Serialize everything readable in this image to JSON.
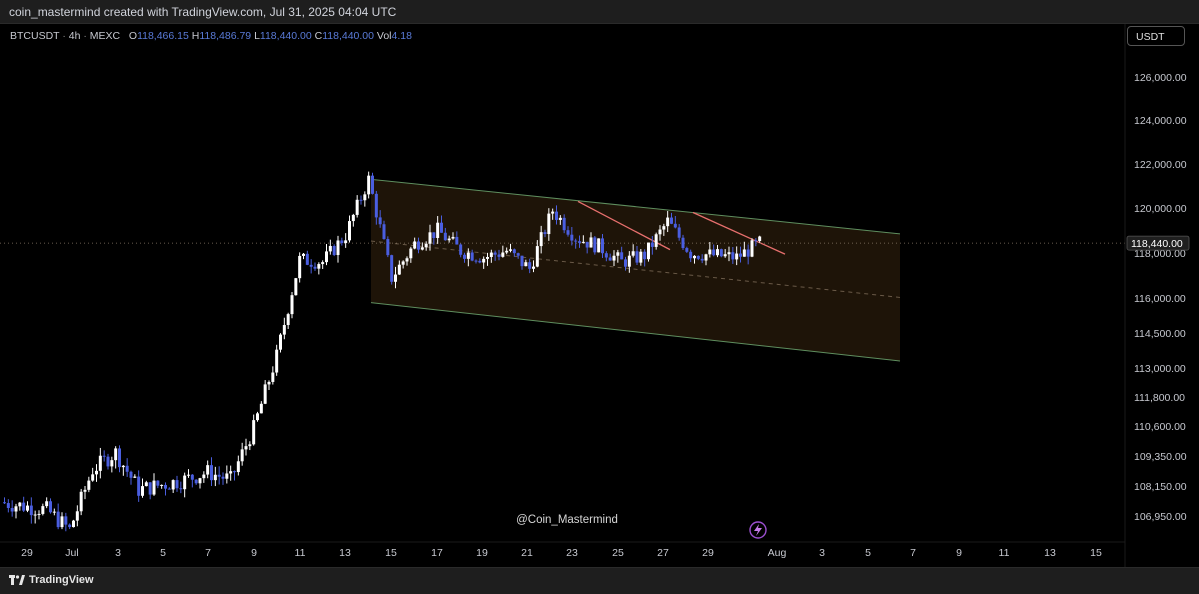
{
  "header": {
    "attribution": "coin_mastermind created with TradingView.com, Jul 31, 2025 04:04 UTC"
  },
  "legend": {
    "symbol": "BTCUSDT",
    "interval": "4h",
    "exchange": "MEXC",
    "o_label": "O",
    "o_value": "118,466.15",
    "h_label": "H",
    "h_value": "118,486.79",
    "l_label": "L",
    "l_value": "118,440.00",
    "c_label": "C",
    "c_value": "118,440.00",
    "vol_label": "Vol",
    "vol_value": "4.18"
  },
  "currency_button": "USDT",
  "watermark": "@Coin_Mastermind",
  "footer": {
    "brand": "TradingView"
  },
  "colors": {
    "up": "#ffffff",
    "down": "#4a5ee0",
    "channel_fill": "#1e1408",
    "channel_line": "#5f8f5f",
    "trendline": "#e8706e",
    "price_label_bg": "#1f1f1f"
  },
  "chart_data": {
    "type": "candlestick",
    "symbol": "BTCUSDT",
    "interval": "4h",
    "x_tick_labels": [
      "29",
      "Jul",
      "3",
      "5",
      "7",
      "9",
      "11",
      "13",
      "15",
      "17",
      "19",
      "21",
      "23",
      "25",
      "27",
      "29",
      "Aug",
      "3",
      "5",
      "7",
      "9",
      "11",
      "13",
      "15"
    ],
    "y_tick_labels": [
      "126,000.00",
      "124,000.00",
      "122,000.00",
      "120,000.00",
      "118,000.00",
      "116,000.00",
      "114,500.00",
      "113,000.00",
      "111,800.00",
      "110,600.00",
      "109,350.00",
      "108,150.00",
      "106,950.00"
    ],
    "current_price": "118,440.00",
    "close_series": [
      {
        "date": "2025-06-28",
        "close": 107500
      },
      {
        "date": "2025-06-30",
        "close": 107200
      },
      {
        "date": "2025-07-01",
        "close": 106400
      },
      {
        "date": "2025-07-02",
        "close": 108800
      },
      {
        "date": "2025-07-03",
        "close": 109500
      },
      {
        "date": "2025-07-04",
        "close": 108000
      },
      {
        "date": "2025-07-05",
        "close": 108200
      },
      {
        "date": "2025-07-06",
        "close": 108400
      },
      {
        "date": "2025-07-07",
        "close": 108700
      },
      {
        "date": "2025-07-08",
        "close": 108400
      },
      {
        "date": "2025-07-09",
        "close": 110500
      },
      {
        "date": "2025-07-10",
        "close": 113500
      },
      {
        "date": "2025-07-11",
        "close": 117700
      },
      {
        "date": "2025-07-12",
        "close": 117600
      },
      {
        "date": "2025-07-13",
        "close": 118800
      },
      {
        "date": "2025-07-14",
        "close": 121300
      },
      {
        "date": "2025-07-15",
        "close": 116900
      },
      {
        "date": "2025-07-16",
        "close": 118400
      },
      {
        "date": "2025-07-17",
        "close": 119000
      },
      {
        "date": "2025-07-18",
        "close": 118100
      },
      {
        "date": "2025-07-19",
        "close": 117800
      },
      {
        "date": "2025-07-20",
        "close": 118100
      },
      {
        "date": "2025-07-21",
        "close": 117300
      },
      {
        "date": "2025-07-22",
        "close": 119900
      },
      {
        "date": "2025-07-23",
        "close": 118700
      },
      {
        "date": "2025-07-24",
        "close": 118300
      },
      {
        "date": "2025-07-25",
        "close": 117600
      },
      {
        "date": "2025-07-26",
        "close": 117900
      },
      {
        "date": "2025-07-27",
        "close": 119400
      },
      {
        "date": "2025-07-28",
        "close": 118000
      },
      {
        "date": "2025-07-29",
        "close": 117900
      },
      {
        "date": "2025-07-30",
        "close": 117800
      },
      {
        "date": "2025-07-31",
        "close": 118440
      }
    ],
    "annotations": [
      {
        "type": "descending-channel",
        "upper_from": {
          "date": "2025-07-14",
          "price": 121300
        },
        "upper_to": {
          "date": "2025-08-06",
          "price": 118850
        },
        "lower_from": {
          "date": "2025-07-14",
          "price": 115800
        },
        "lower_to": {
          "date": "2025-08-06",
          "price": 113300
        }
      },
      {
        "type": "trendline",
        "from": {
          "date": "2025-07-23",
          "price": 120300
        },
        "to": {
          "date": "2025-07-27",
          "price": 118150
        }
      },
      {
        "type": "trendline",
        "from": {
          "date": "2025-07-28",
          "price": 119800
        },
        "to": {
          "date": "2025-08-01",
          "price": 117950
        }
      }
    ]
  }
}
